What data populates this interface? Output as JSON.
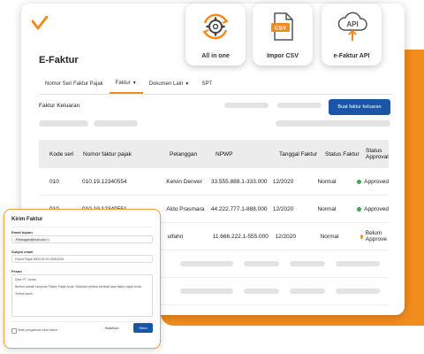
{
  "app": {
    "title": "E-Faktur"
  },
  "colors": {
    "accent": "#f28c1e",
    "primary": "#1a56a8",
    "approved": "#3aa84f",
    "pending": "#f0932b"
  },
  "tabs": [
    {
      "label": "Nomor Seri Faktur Pajak",
      "caret": false
    },
    {
      "label": "Faktur",
      "caret": true
    },
    {
      "label": "Dokumen Lain",
      "caret": true
    },
    {
      "label": "SPT",
      "caret": false
    }
  ],
  "section": {
    "title": "Faktur Keluaran",
    "create_button": "Buat faktur keluaran"
  },
  "table": {
    "headers": [
      "Kode seri",
      "Nomor faktur pajak",
      "Pelanggan",
      "NPWP",
      "Tanggal Faktur",
      "Status Faktur",
      "Status Approval"
    ],
    "rows": [
      {
        "kode": "010",
        "nomor": "010.19.12340554",
        "pelanggan": "Kelvin Denver",
        "npwp": "33.555.888.1-333.000",
        "tanggal": "12/2020",
        "status": "Normal",
        "approval": "Approved",
        "approval_color": "#3aa84f"
      },
      {
        "kode": "010",
        "nomor": "010.19.12340551",
        "pelanggan": "Aldo Prasmara",
        "npwp": "44.222.777.1-888.000",
        "tanggal": "12/2020",
        "status": "Normal",
        "approval": "Approved",
        "approval_color": "#3aa84f"
      },
      {
        "kode": "",
        "nomor": "",
        "pelanggan": "ulfahri",
        "npwp": "11.666.222.1-555.000",
        "tanggal": "12/2020",
        "status": "Normal",
        "approval": "Belum Approve",
        "approval_color": "#f0932b"
      }
    ]
  },
  "features": [
    {
      "label": "All in one",
      "icon": "gear-cycle-icon"
    },
    {
      "label": "Impor CSV",
      "icon": "csv-file-icon"
    },
    {
      "label": "e-Faktur API",
      "icon": "cloud-api-icon"
    }
  ],
  "modal": {
    "title": "Kirim Faktur",
    "email_label": "Email tujuan",
    "email_chip": "Pelanggan@mail.com",
    "subject_label": "Subjek email",
    "subject_value": "Faktur Pajak 8000-02-00-00000235",
    "message_label": "Pesan",
    "message_line1": "Dear PT Jurnal,",
    "message_line2": "Berikut adalah lampiran Faktur Pajak Anda. Silahkan periksa kembali data faktur pajak Anda.",
    "message_line3": "Terima kasih.",
    "checkbox_label": "Ubah pengaturan kirim faktur",
    "cancel": "Batalkan",
    "send": "Kirim"
  }
}
